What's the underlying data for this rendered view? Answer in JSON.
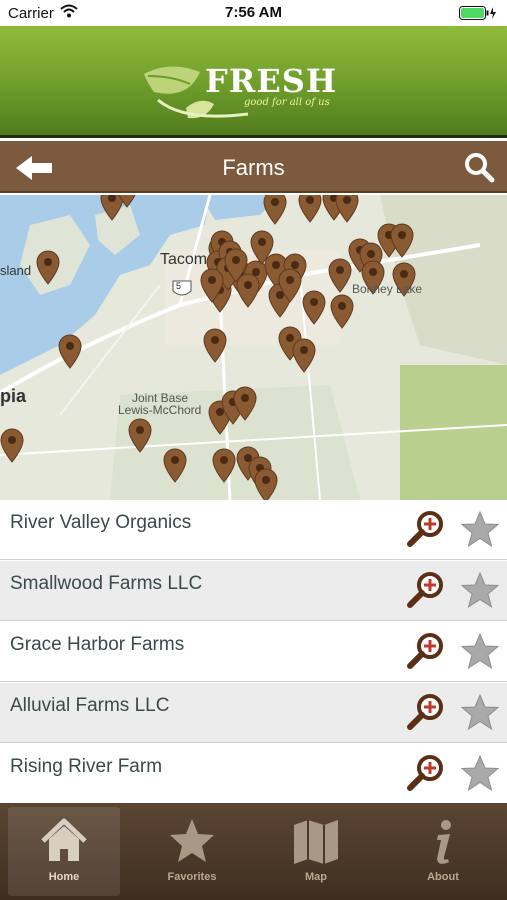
{
  "status_bar": {
    "carrier": "Carrier",
    "time": "7:56 AM"
  },
  "brand": {
    "name": "FRESH",
    "tagline": "good for all of us"
  },
  "nav": {
    "title": "Farms",
    "back_icon": "back-arrow-icon",
    "search_icon": "search-icon"
  },
  "map": {
    "labels": [
      "Tacom",
      "sland",
      "pia",
      "Joint Base",
      "Lewis-McChord",
      "Bonney Lake"
    ],
    "highway_shield": "5",
    "marker_count": 46
  },
  "farms": [
    {
      "name": "River Valley Organics"
    },
    {
      "name": "Smallwood Farms LLC"
    },
    {
      "name": "Grace Harbor Farms"
    },
    {
      "name": "Alluvial Farms LLC"
    },
    {
      "name": "Rising River Farm"
    }
  ],
  "tabs": [
    {
      "label": "Home",
      "icon": "home-icon",
      "active": true
    },
    {
      "label": "Favorites",
      "icon": "star-icon",
      "active": false
    },
    {
      "label": "Map",
      "icon": "map-icon",
      "active": false
    },
    {
      "label": "About",
      "icon": "info-icon",
      "active": false
    }
  ],
  "colors": {
    "header_green": "#6e9c2a",
    "nav_brown": "#7c5a3d",
    "marker_brown": "#8a5a33",
    "tab_bar": "#4a3828"
  }
}
